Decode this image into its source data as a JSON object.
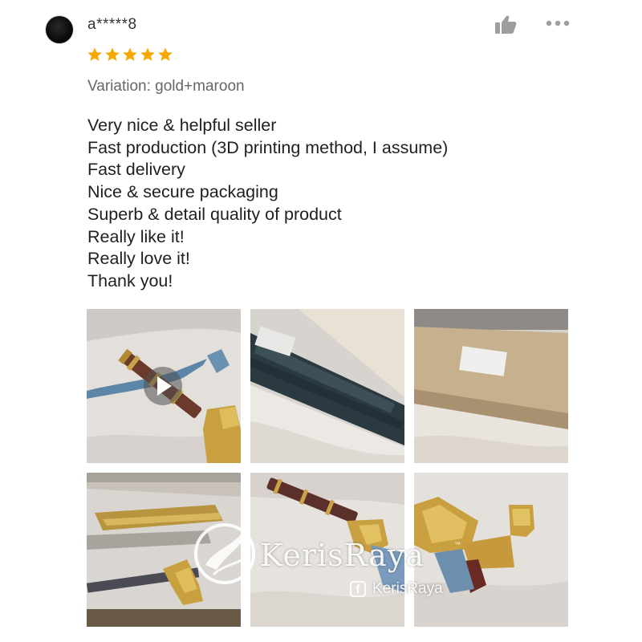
{
  "review": {
    "username": "a*****8",
    "rating": 5,
    "variation": "Variation: gold+maroon",
    "lines": [
      "Very nice & helpful seller",
      "Fast production (3D printing method, I assume)",
      "Fast delivery",
      "Nice & secure packaging",
      "Superb & detail quality of product",
      "Really like it!",
      "Really love it!",
      "Thank you!"
    ]
  },
  "colors": {
    "star": "#f6a700",
    "text": "#1f1f1f",
    "muted": "#666666",
    "icon": "#9e9e9e"
  },
  "icons": {
    "like": "thumbs-up-icon",
    "more": "more-horizontal-icon",
    "video": "play-icon"
  },
  "watermark": {
    "brand": "KerisRaya",
    "tm": "™",
    "facebook_handle": "KerisRaya",
    "facebook_glyph": "f"
  }
}
